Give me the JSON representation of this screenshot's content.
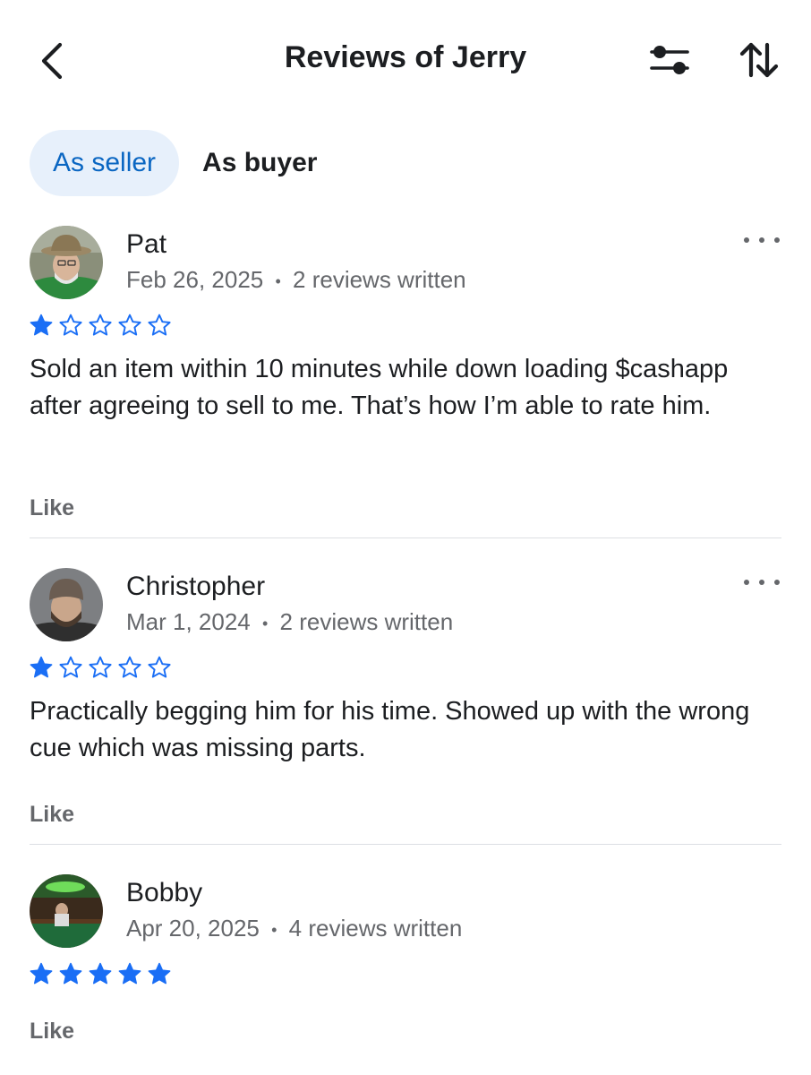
{
  "header": {
    "title": "Reviews of Jerry",
    "back_icon": "chevron-left-icon",
    "filter_icon": "sliders-icon",
    "sort_icon": "sort-arrows-icon"
  },
  "tabs": [
    {
      "label": "As seller",
      "active": true
    },
    {
      "label": "As buyer",
      "active": false
    }
  ],
  "colors": {
    "accent": "#0a66c2",
    "star": "#1a6ef5",
    "tab_active_bg": "#e7f0fb",
    "secondary_text": "#65676b"
  },
  "reviews": [
    {
      "name": "Pat",
      "date": "Feb 26, 2025",
      "separator": "•",
      "reviews_written": "2 reviews written",
      "rating": 1,
      "max_rating": 5,
      "text": "Sold an item within 10 minutes while down loading $cashapp after agreeing to sell to me. That’s how I’m able to rate him.",
      "like_label": "Like"
    },
    {
      "name": "Christopher",
      "date": "Mar 1, 2024",
      "separator": "•",
      "reviews_written": "2 reviews written",
      "rating": 1,
      "max_rating": 5,
      "text": "Practically begging him for his time. Showed up with the wrong cue which was missing parts.",
      "like_label": "Like"
    },
    {
      "name": "Bobby",
      "date": "Apr 20, 2025",
      "separator": "•",
      "reviews_written": "4 reviews written",
      "rating": 5,
      "max_rating": 5,
      "text": "",
      "like_label": "Like"
    }
  ]
}
